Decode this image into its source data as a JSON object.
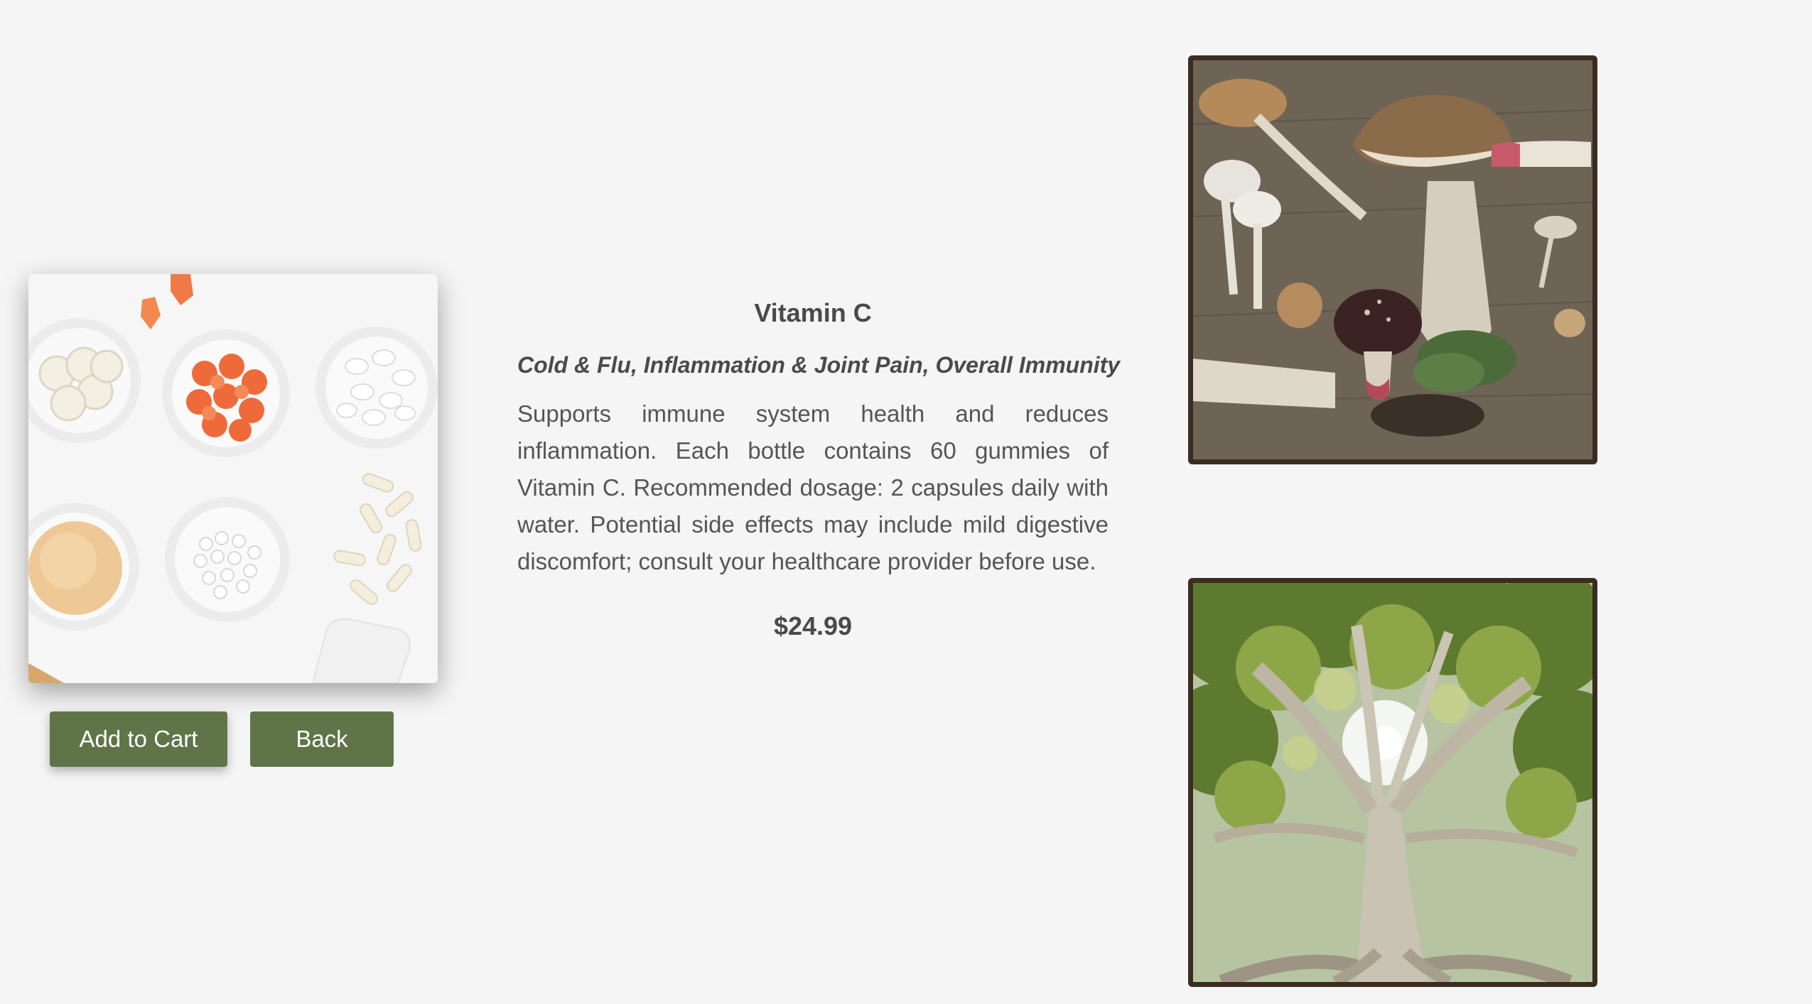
{
  "product": {
    "name": "Vitamin C",
    "tags": "Cold & Flu, Inflammation & Joint Pain, Overall Immunity",
    "description": "Supports immune system health and reduces inflammation. Each bottle contains 60 gummies of Vitamin C. Recommended dosage: 2 capsules daily with water. Potential side effects may include mild digestive discomfort; consult your healthcare provider before use.",
    "price": "$24.99"
  },
  "actions": {
    "add_to_cart_label": "Add to Cart",
    "back_label": "Back"
  },
  "colors": {
    "background": "#f5f5f5",
    "button": "#5f7548",
    "photo_frame": "#3b2c20",
    "text": "#4a4a4a"
  }
}
